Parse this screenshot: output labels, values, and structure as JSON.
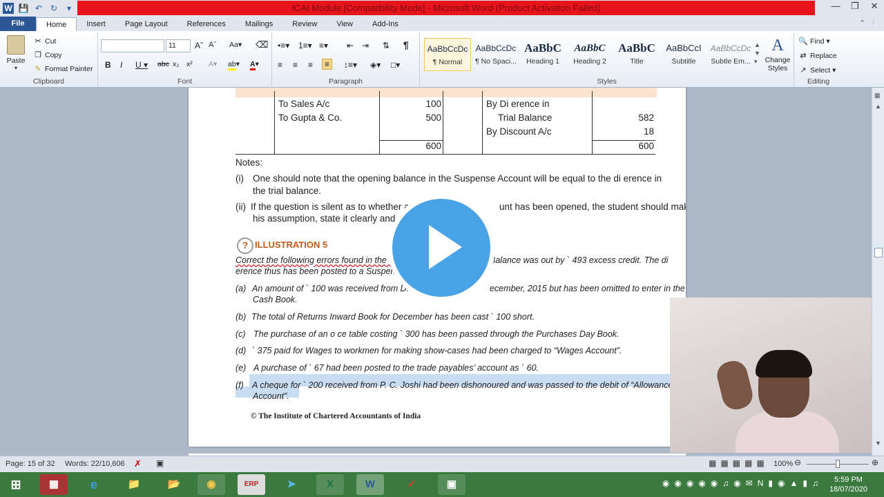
{
  "window": {
    "title": "ICAI Module [Compatibility Mode] - Microsoft Word (Product Activation Failed)"
  },
  "tabs": [
    "File",
    "Home",
    "Insert",
    "Page Layout",
    "References",
    "Mailings",
    "Review",
    "View",
    "Add-Ins"
  ],
  "ribbon": {
    "clipboard": {
      "label": "Clipboard",
      "paste": "Paste",
      "cut": "Cut",
      "copy": "Copy",
      "format_painter": "Format Painter"
    },
    "font": {
      "label": "Font",
      "name": "",
      "size": "11"
    },
    "paragraph": {
      "label": "Paragraph"
    },
    "styles": {
      "label": "Styles",
      "items": [
        {
          "preview": "AaBbCcDc",
          "name": "¶ Normal"
        },
        {
          "preview": "AaBbCcDc",
          "name": "¶ No Spaci..."
        },
        {
          "preview": "AaBbC",
          "name": "Heading 1"
        },
        {
          "preview": "AaBbC",
          "name": "Heading 2"
        },
        {
          "preview": "AaBbC",
          "name": "Title"
        },
        {
          "preview": "AaBbCcI",
          "name": "Subtitle"
        },
        {
          "preview": "AaBbCcDc",
          "name": "Subtle Em..."
        }
      ],
      "change_styles": "Change Styles"
    },
    "editing": {
      "label": "Editing",
      "find": "Find",
      "replace": "Replace",
      "select": "Select"
    }
  },
  "document": {
    "ledger": {
      "left": [
        {
          "text": "To Sales A/c",
          "amount": "100"
        },
        {
          "text": "To Gupta & Co.",
          "amount": "500"
        }
      ],
      "left_total": "600",
      "right": [
        {
          "text": "By Di erence in",
          "amount": ""
        },
        {
          "text": "Trial Balance",
          "amount": "582"
        },
        {
          "text": "By Discount A/c",
          "amount": "18"
        }
      ],
      "right_total": "600"
    },
    "notes_heading": "Notes:",
    "note1_num": "(i)",
    "note1_line1": "One should note that the opening balance in the Suspense Account will be equal to the di  erence in",
    "note1_line2": "the trial balance.",
    "note2_num": "(ii)",
    "note2_line1": "If the question is silent as to whether a S",
    "note2_line1b": "unt has been opened, the student should make",
    "note2_line2": "his assumption, state it clearly and th",
    "illustration": "ILLUSTRATION 5",
    "intro_line1a": "Correct the following errors found in the bo",
    "intro_line1b": "Balance was out by `  493 excess credit. The di",
    "intro_line2": "erence thus has been posted to a Suspense",
    "items": [
      {
        "num": "(a)",
        "line1": "An amount of `  100 was received from D. L",
        "line1b": "ecember, 2015 but has been omitted to enter in the",
        "line2": "Cash Book."
      },
      {
        "num": "(b)",
        "line1": "The total of Returns Inward Book for December has been cast `  100 short."
      },
      {
        "num": "(c)",
        "line1": "The purchase of an o  ce table costing `  300 has been passed through the Purchases Day Book."
      },
      {
        "num": "(d)",
        "line1": "`  375 paid for Wages to workmen for making show-cases had been charged to “Wages Account”."
      },
      {
        "num": "(e)",
        "line1": "A purchase of `  67 had been posted to the trade payables’ account as `  60."
      },
      {
        "num": "(f)",
        "line1": "A cheque for `  200 received from P. C. Joshi had been dishonoured and was passed to the debit of “Allowances",
        "line2": "Account”."
      }
    ],
    "footer": "© The Institute of Chartered Accountants of India"
  },
  "status": {
    "page": "Page: 15 of 32",
    "words": "Words: 22/10,606",
    "zoom": "100%"
  },
  "clock": {
    "time": "5:59 PM",
    "date": "18/07/2020"
  }
}
